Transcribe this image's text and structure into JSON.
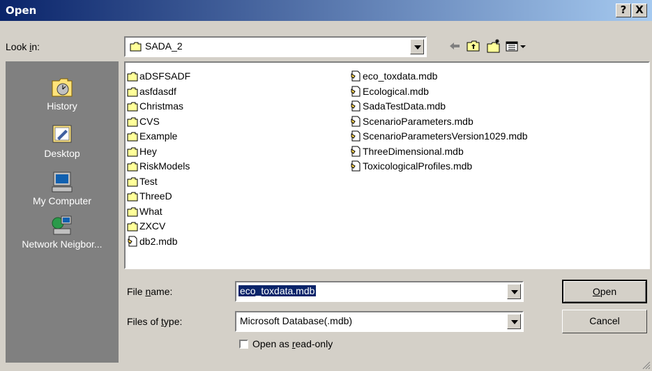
{
  "window": {
    "title": "Open",
    "help_button": "?",
    "close_button": "X"
  },
  "lookin": {
    "label_prefix": "Look ",
    "label_key": "i",
    "label_suffix": "n:",
    "value": "SADA_2"
  },
  "places": [
    {
      "label": "History",
      "icon": "history-icon"
    },
    {
      "label": "Desktop",
      "icon": "desktop-icon"
    },
    {
      "label": "My Computer",
      "icon": "my-computer-icon"
    },
    {
      "label": "Network Neigbor...",
      "icon": "network-neighborhood-icon"
    }
  ],
  "folders": [
    "aDSFSADF",
    "asfdasdf",
    "Christmas",
    "CVS",
    "Example",
    "Hey",
    "RiskModels",
    "Test",
    "ThreeD",
    "What",
    "ZXCV"
  ],
  "files_col1": [
    "db2.mdb"
  ],
  "files_col2": [
    "eco_toxdata.mdb",
    "Ecological.mdb",
    "SadaTestData.mdb",
    "ScenarioParameters.mdb",
    "ScenarioParametersVersion1029.mdb",
    "ThreeDimensional.mdb",
    "ToxicologicalProfiles.mdb"
  ],
  "filename": {
    "label_prefix": "File ",
    "label_key": "n",
    "label_suffix": "ame:",
    "value": "eco_toxdata.mdb"
  },
  "filetype": {
    "label_prefix": "Files of ",
    "label_key": "t",
    "label_suffix": "ype:",
    "value": "Microsoft Database(.mdb)"
  },
  "readonly": {
    "label_prefix": "Open as ",
    "label_key": "r",
    "label_suffix": "ead-only",
    "checked": false
  },
  "buttons": {
    "open_key": "O",
    "open_rest": "pen",
    "cancel": "Cancel"
  }
}
